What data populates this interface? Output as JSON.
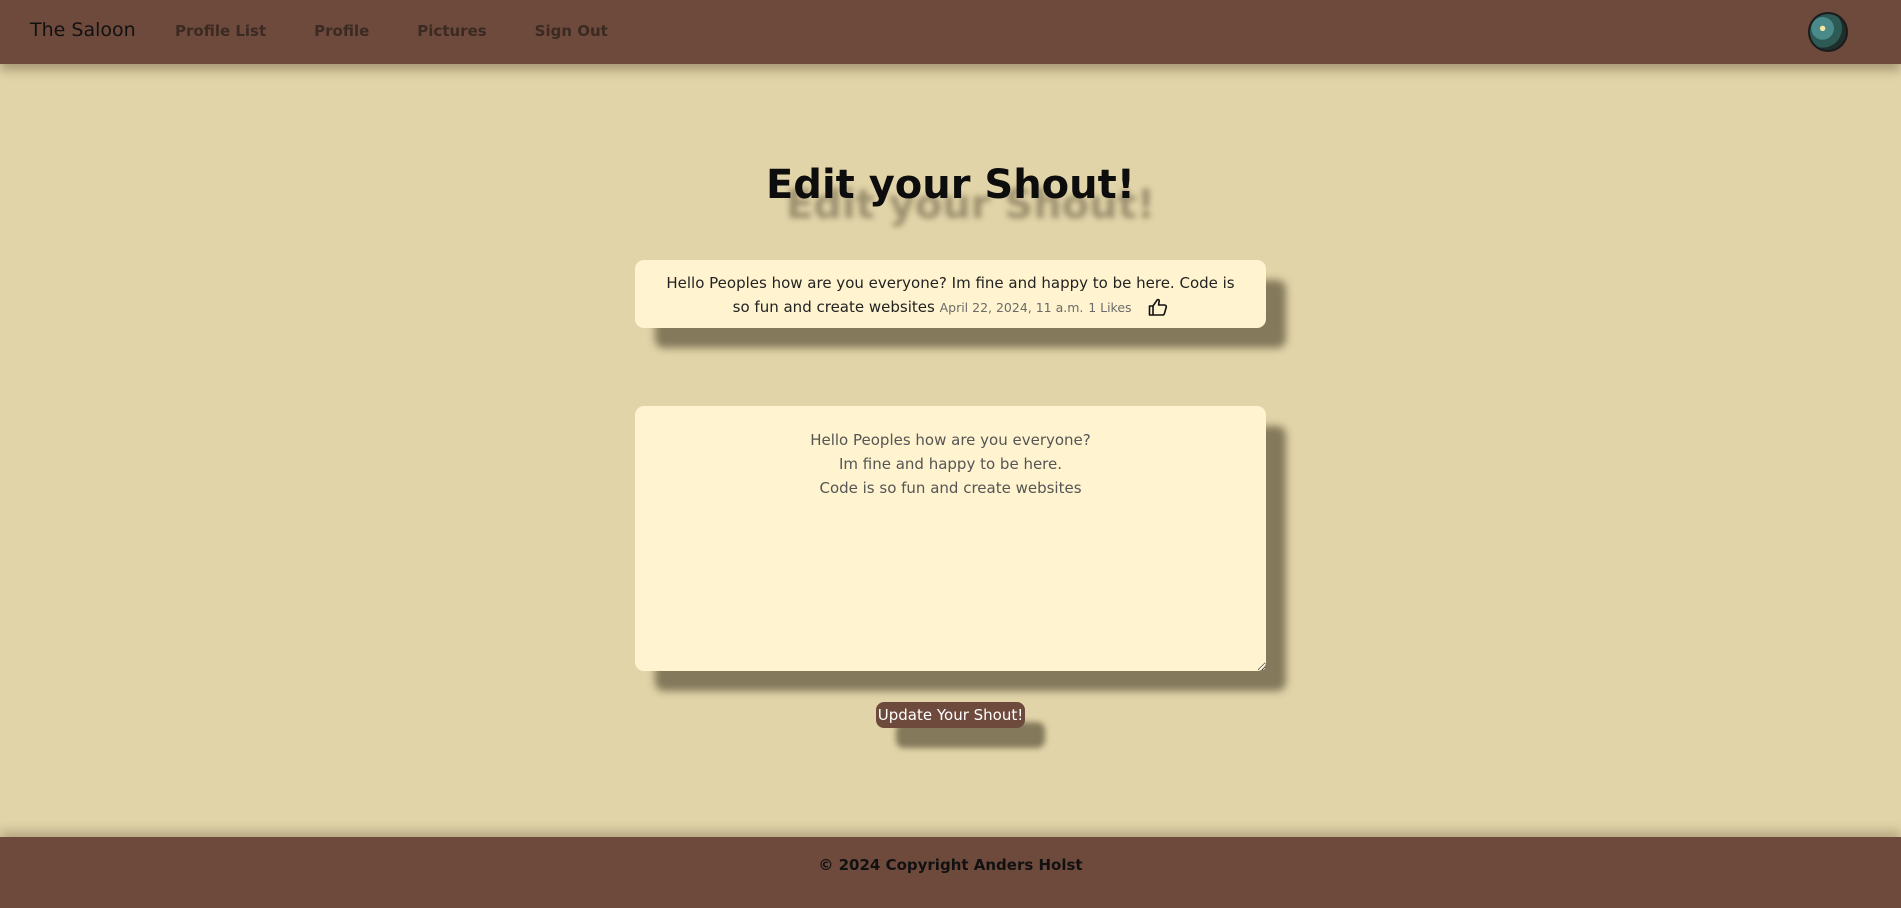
{
  "navbar": {
    "brand": "The Saloon",
    "links": [
      {
        "label": "Profile List"
      },
      {
        "label": "Profile"
      },
      {
        "label": "Pictures"
      },
      {
        "label": "Sign Out"
      }
    ],
    "avatar_icon": "user-avatar"
  },
  "main": {
    "title": "Edit your Shout!",
    "shout": {
      "text": "Hello Peoples how are you everyone? Im fine and happy to be here. Code is so fun and create websites",
      "date": "April 22, 2024, 11 a.m.",
      "likes": "1 Likes",
      "like_icon": "thumbs-up-icon"
    },
    "edit": {
      "value": "Hello Peoples how are you everyone?\nIm fine and happy to be here.\nCode is so fun and create websites",
      "submit_label": "Update Your Shout!"
    }
  },
  "footer": {
    "text": "© 2024 Copyright Anders Holst"
  },
  "colors": {
    "background": "#e1d4a8",
    "bar": "#6e4a3d",
    "card": "#fff4cf"
  }
}
